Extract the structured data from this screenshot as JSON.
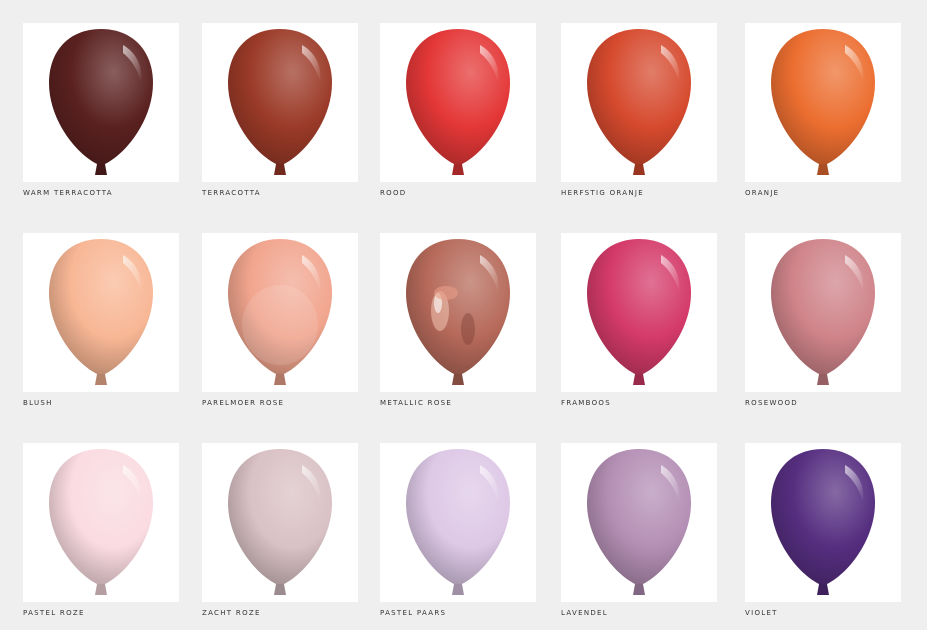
{
  "swatches": [
    {
      "name": "WARM TERRACOTTA",
      "color": "#5a2120",
      "finish": "standard"
    },
    {
      "name": "TERRACOTTA",
      "color": "#9b3a28",
      "finish": "standard"
    },
    {
      "name": "ROOD",
      "color": "#e43737",
      "finish": "standard"
    },
    {
      "name": "HERFSTIG ORANJE",
      "color": "#d64a2e",
      "finish": "standard"
    },
    {
      "name": "ORANJE",
      "color": "#ec6e30",
      "finish": "standard"
    },
    {
      "name": "BLUSH",
      "color": "#f8b795",
      "finish": "standard"
    },
    {
      "name": "PARELMOER ROSE",
      "color": "#f1a58e",
      "finish": "pearl"
    },
    {
      "name": "METALLIC ROSE",
      "color": "#b66a5a",
      "finish": "metallic"
    },
    {
      "name": "FRAMBOOS",
      "color": "#d43a6a",
      "finish": "standard"
    },
    {
      "name": "ROSEWOOD",
      "color": "#cf848a",
      "finish": "standard"
    },
    {
      "name": "PASTEL ROZE",
      "color": "#fadbe1",
      "finish": "standard"
    },
    {
      "name": "ZACHT ROZE",
      "color": "#d9c1c5",
      "finish": "standard"
    },
    {
      "name": "PASTEL PAARS",
      "color": "#ddc8e6",
      "finish": "standard"
    },
    {
      "name": "LAVENDEL",
      "color": "#b48fb5",
      "finish": "standard"
    },
    {
      "name": "VIOLET",
      "color": "#562e80",
      "finish": "standard"
    }
  ]
}
